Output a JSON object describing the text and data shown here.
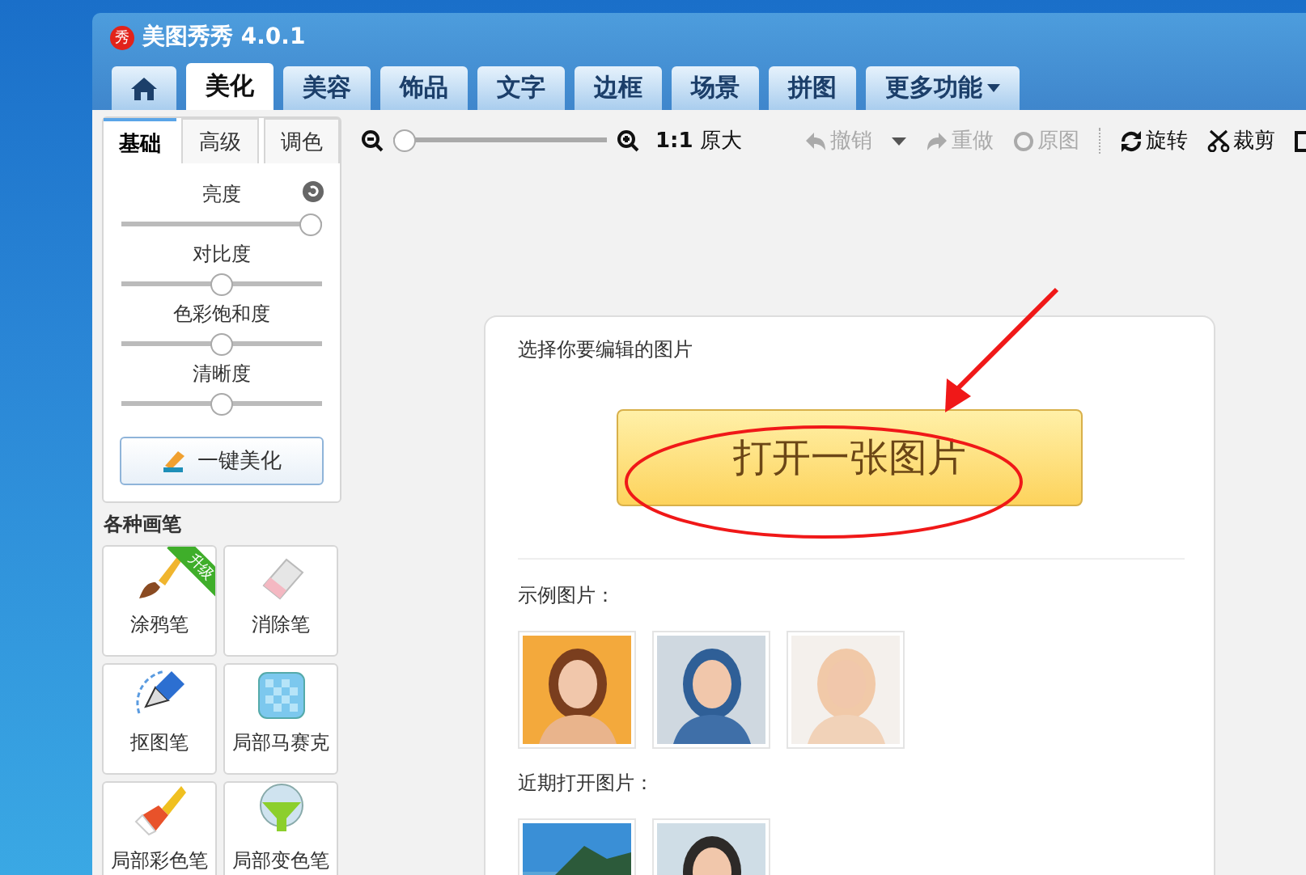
{
  "window": {
    "title": "美图秀秀 4.0.1",
    "logo": "秀"
  },
  "tabs": [
    {
      "kind": "home",
      "selected": false
    },
    {
      "kind": "text",
      "label": "美化",
      "selected": true
    },
    {
      "kind": "text",
      "label": "美容",
      "selected": false
    },
    {
      "kind": "text",
      "label": "饰品",
      "selected": false
    },
    {
      "kind": "text",
      "label": "文字",
      "selected": false
    },
    {
      "kind": "text",
      "label": "边框",
      "selected": false
    },
    {
      "kind": "text",
      "label": "场景",
      "selected": false
    },
    {
      "kind": "text",
      "label": "拼图",
      "selected": false
    },
    {
      "kind": "menu",
      "label": "更多功能",
      "selected": false
    }
  ],
  "sidebar": {
    "tabs": [
      {
        "label": "基础",
        "selected": true
      },
      {
        "label": "高级",
        "selected": false
      },
      {
        "label": "调色",
        "selected": false
      }
    ],
    "sliders": [
      {
        "label": "亮度",
        "level": 1.0
      },
      {
        "label": "对比度",
        "level": 0.5
      },
      {
        "label": "色彩饱和度",
        "level": 0.5
      },
      {
        "label": "清晰度",
        "level": 0.5
      }
    ],
    "auto_button": "一键美化",
    "brushes_title": "各种画笔",
    "brushes": [
      {
        "kind": "brush",
        "label": "涂鸦笔",
        "badge": "升级"
      },
      {
        "kind": "eraser",
        "label": "消除笔"
      },
      {
        "kind": "pen",
        "label": "抠图笔"
      },
      {
        "kind": "mosaic",
        "label": "局部马赛克"
      },
      {
        "kind": "paint",
        "label": "局部彩色笔"
      },
      {
        "kind": "bucket",
        "label": "局部变色笔"
      }
    ]
  },
  "zoom": {
    "level": 0.0,
    "ratio": "1:1",
    "label": "原大"
  },
  "toolbar": [
    {
      "kind": "undo",
      "label": "撤销",
      "disabled": true
    },
    {
      "kind": "caret"
    },
    {
      "kind": "redo",
      "label": "重做",
      "disabled": true
    },
    {
      "kind": "original",
      "label": "原图",
      "disabled": true
    },
    {
      "kind": "rotate",
      "label": "旋转",
      "disabled": false
    },
    {
      "kind": "crop",
      "label": "裁剪",
      "disabled": false
    },
    {
      "kind": "more"
    }
  ],
  "main": {
    "prompt": "选择你要编辑的图片",
    "open_button": "打开一张图片",
    "samples_title": "示例图片：",
    "recent_title": "近期打开图片："
  },
  "annotations": {
    "arrow": true,
    "ellipse": true
  }
}
